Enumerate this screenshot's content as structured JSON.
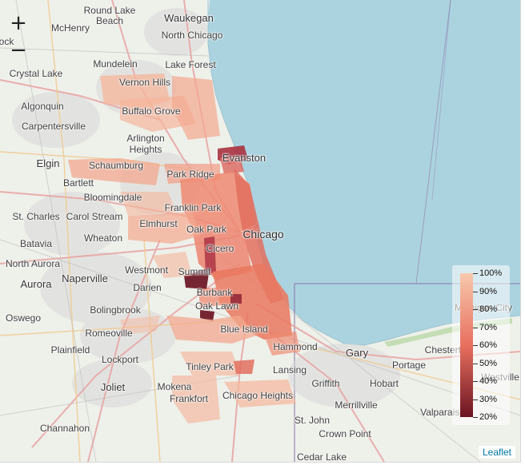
{
  "map": {
    "attribution": "Leaflet",
    "zoom_in_label": "+",
    "zoom_out_label": "−"
  },
  "places": [
    {
      "name": "Round Lake",
      "cls": ""
    },
    {
      "name": "Beach",
      "cls": ""
    },
    {
      "name": "Waukegan",
      "cls": "medium"
    },
    {
      "name": "McHenry",
      "cls": ""
    },
    {
      "name": "North Chicago",
      "cls": ""
    },
    {
      "name": "ock",
      "cls": ""
    },
    {
      "name": "Mundelein",
      "cls": ""
    },
    {
      "name": "Lake Forest",
      "cls": ""
    },
    {
      "name": "Crystal Lake",
      "cls": ""
    },
    {
      "name": "Vernon Hills",
      "cls": ""
    },
    {
      "name": "Algonquin",
      "cls": ""
    },
    {
      "name": "Buffalo Grove",
      "cls": ""
    },
    {
      "name": "Carpentersville",
      "cls": ""
    },
    {
      "name": "Arlington",
      "cls": ""
    },
    {
      "name": "Heights",
      "cls": ""
    },
    {
      "name": "Evanston",
      "cls": "medium"
    },
    {
      "name": "Elgin",
      "cls": "medium"
    },
    {
      "name": "Schaumburg",
      "cls": ""
    },
    {
      "name": "Park Ridge",
      "cls": ""
    },
    {
      "name": "Bartlett",
      "cls": ""
    },
    {
      "name": "Bloomingdale",
      "cls": ""
    },
    {
      "name": "Franklin Park",
      "cls": ""
    },
    {
      "name": "St. Charles",
      "cls": ""
    },
    {
      "name": "Carol Stream",
      "cls": ""
    },
    {
      "name": "Elmhurst",
      "cls": ""
    },
    {
      "name": "Oak Park",
      "cls": ""
    },
    {
      "name": "Chicago",
      "cls": "big"
    },
    {
      "name": "Batavia",
      "cls": ""
    },
    {
      "name": "Wheaton",
      "cls": ""
    },
    {
      "name": "Cicero",
      "cls": ""
    },
    {
      "name": "North Aurora",
      "cls": ""
    },
    {
      "name": "Westmont",
      "cls": ""
    },
    {
      "name": "Summit",
      "cls": ""
    },
    {
      "name": "Aurora",
      "cls": "medium"
    },
    {
      "name": "Naperville",
      "cls": "medium"
    },
    {
      "name": "Darien",
      "cls": ""
    },
    {
      "name": "Burbank",
      "cls": ""
    },
    {
      "name": "Bolingbrook",
      "cls": ""
    },
    {
      "name": "Oak Lawn",
      "cls": ""
    },
    {
      "name": "Michigan City",
      "cls": ""
    },
    {
      "name": "Oswego",
      "cls": ""
    },
    {
      "name": "Romeoville",
      "cls": ""
    },
    {
      "name": "Blue Island",
      "cls": ""
    },
    {
      "name": "Plainfield",
      "cls": ""
    },
    {
      "name": "Hammond",
      "cls": ""
    },
    {
      "name": "Gary",
      "cls": "medium"
    },
    {
      "name": "Chesterton",
      "cls": ""
    },
    {
      "name": "Lockport",
      "cls": ""
    },
    {
      "name": "Portage",
      "cls": ""
    },
    {
      "name": "Tinley Park",
      "cls": ""
    },
    {
      "name": "Lansing",
      "cls": ""
    },
    {
      "name": "Westville",
      "cls": ""
    },
    {
      "name": "Griffith",
      "cls": ""
    },
    {
      "name": "Hobart",
      "cls": ""
    },
    {
      "name": "Joliet",
      "cls": "medium"
    },
    {
      "name": "Mokena",
      "cls": ""
    },
    {
      "name": "Frankfort",
      "cls": ""
    },
    {
      "name": "Chicago Heights",
      "cls": ""
    },
    {
      "name": "Merrillville",
      "cls": ""
    },
    {
      "name": "Valparaiso",
      "cls": ""
    },
    {
      "name": "St. John",
      "cls": ""
    },
    {
      "name": "Channahon",
      "cls": ""
    },
    {
      "name": "Crown Point",
      "cls": ""
    },
    {
      "name": "Cedar Lake",
      "cls": ""
    }
  ],
  "legend": {
    "ticks": [
      {
        "label": "100%",
        "pct": 100
      },
      {
        "label": "90%",
        "pct": 90
      },
      {
        "label": "80%",
        "pct": 80
      },
      {
        "label": "70%",
        "pct": 70
      },
      {
        "label": "60%",
        "pct": 60
      },
      {
        "label": "50%",
        "pct": 50
      },
      {
        "label": "40%",
        "pct": 40
      },
      {
        "label": "30%",
        "pct": 30
      },
      {
        "label": "20%",
        "pct": 20
      }
    ],
    "color_high": "#f7c9ad",
    "color_mid": "#e8705f",
    "color_low": "#6b1422"
  },
  "colors": {
    "water": "#abd3df",
    "land": "#eef0ea",
    "choropleth_light": "#f5b59b",
    "choropleth_mid": "#ee8a72",
    "choropleth_dark": "#b03a48",
    "choropleth_darkest": "#6e1a28"
  }
}
